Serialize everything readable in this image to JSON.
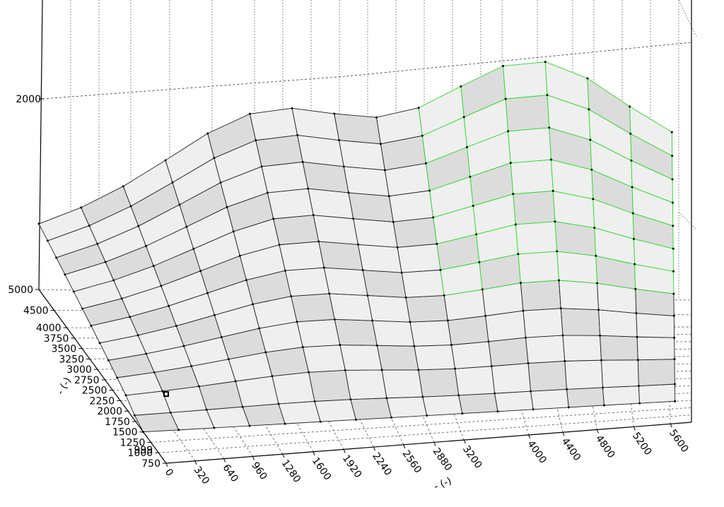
{
  "chart_data": {
    "type": "surface3d",
    "x_axis": {
      "label": "- (-)",
      "ticks": [
        "0",
        "320",
        "640",
        "960",
        "1280",
        "1600",
        "1920",
        "2240",
        "2560",
        "2880",
        "3200",
        "4000",
        "4400",
        "4800",
        "5200",
        "5600"
      ]
    },
    "y_axis": {
      "label": "- (-)",
      "ticks": [
        "750",
        "1000",
        "1250",
        "1500",
        "1750",
        "2000",
        "2250",
        "2500",
        "2750",
        "3000",
        "3250",
        "3500",
        "3750",
        "4000",
        "4500",
        "5000"
      ],
      "extra_tick": "999"
    },
    "z_axis": {
      "ticks": [
        "2000"
      ]
    },
    "grid": true,
    "colors": {
      "surface_fill": "#efefef",
      "surface_fill_alt": "#dcdcdc",
      "mesh": "#222222",
      "mesh_highlight": "#22dd22",
      "grid": "#555555"
    }
  }
}
